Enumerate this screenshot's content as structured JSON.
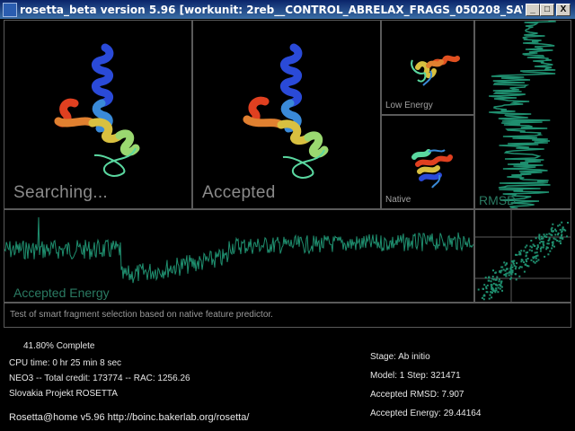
{
  "window": {
    "title": "rosetta_beta version 5.96 [workunit: 2reb__CONTROL_ABRELAX_FRAGS_050208_SAVE_ALL_OUT...",
    "minimize_label": "_",
    "maximize_label": "□",
    "close_label": "X"
  },
  "panels": {
    "searching_label": "Searching...",
    "accepted_label": "Accepted",
    "low_energy_label": "Low Energy",
    "native_label": "Native",
    "rmsd_label": "RMSD",
    "accepted_energy_label": "Accepted Energy"
  },
  "description": "Test of smart fragment selection based on native feature predictor.",
  "progress": {
    "complete": "41.80% Complete",
    "cpu_time": "CPU time: 0 hr 25 min 8 sec",
    "credit": "NEO3 -- Total credit: 173774 -- RAC: 1256.26",
    "team": "Slovakia Projekt ROSETTA",
    "footer": "Rosetta@home v5.96 http://boinc.bakerlab.org/rosetta/"
  },
  "stage": {
    "stage": "Stage: Ab initio",
    "model_step": "Model: 1   Step: 321471",
    "accepted_rmsd": "Accepted RMSD:   7.907",
    "accepted_energy": "Accepted Energy: 29.44164"
  },
  "colors": {
    "trace": "#1f8f6f",
    "border": "#5a5a5a"
  }
}
